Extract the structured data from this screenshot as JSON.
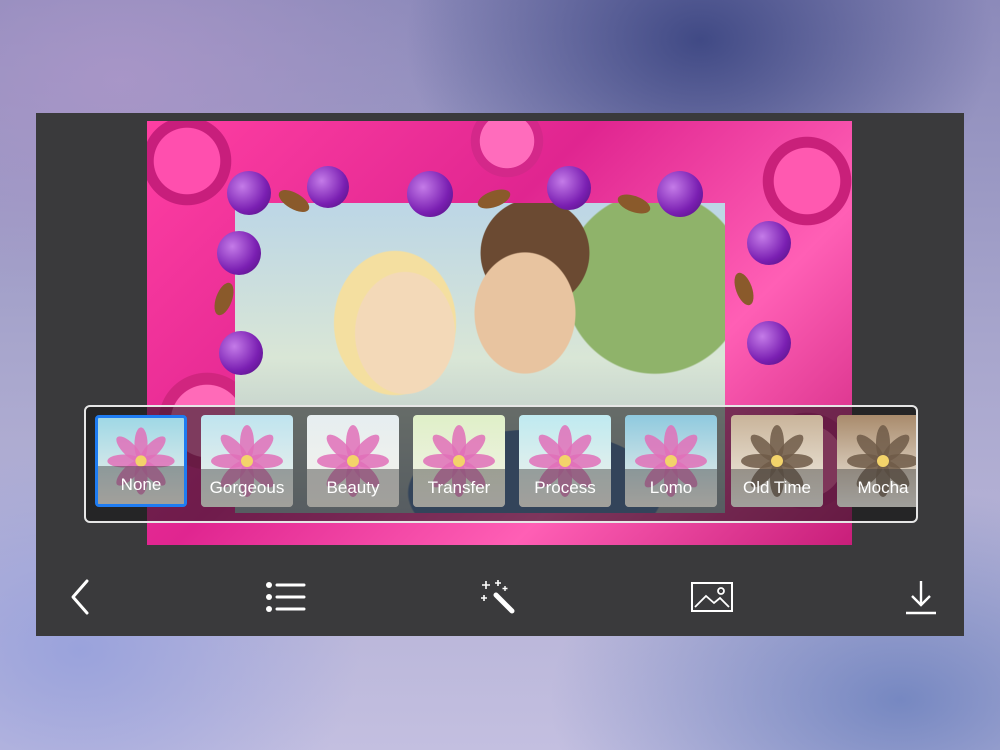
{
  "filters": {
    "selected": "None",
    "items": [
      {
        "label": "None",
        "tint": "#9fd8e6"
      },
      {
        "label": "Gorgeous",
        "tint": "#bfe4ef"
      },
      {
        "label": "Beauty",
        "tint": "#e6eef0"
      },
      {
        "label": "Transfer",
        "tint": "#dff0c8"
      },
      {
        "label": "Process",
        "tint": "#bfeaf0"
      },
      {
        "label": "Lomo",
        "tint": "#8fcadf"
      },
      {
        "label": "Old Time",
        "tint": "#c9b49a"
      },
      {
        "label": "Mocha",
        "tint": "#a98b6c"
      }
    ]
  },
  "toolbar": {
    "icons": [
      "back-arrow-icon",
      "list-icon",
      "magic-wand-icon",
      "image-icon",
      "download-icon"
    ]
  },
  "colors": {
    "accent": "#1e7cf2",
    "panel": "#3a3a3c",
    "icon": "#ffffff"
  }
}
